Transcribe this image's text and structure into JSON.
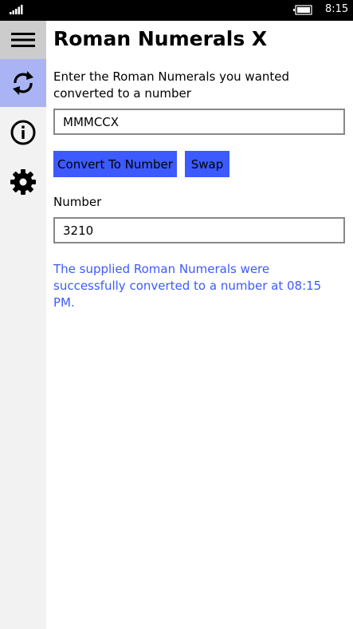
{
  "status_bar": {
    "time": "8:15",
    "icons": [
      "signal-strength-icon",
      "battery-charging-icon"
    ]
  },
  "sidebar": {
    "items": [
      {
        "name": "menu",
        "icon": "hamburger-menu-icon",
        "selected": false
      },
      {
        "name": "convert",
        "icon": "refresh-icon",
        "selected": true
      },
      {
        "name": "about",
        "icon": "info-icon",
        "selected": false
      },
      {
        "name": "settings",
        "icon": "gear-icon",
        "selected": false
      }
    ]
  },
  "main": {
    "title": "Roman Numerals X",
    "prompt": "Enter the Roman Numerals you wanted converted to a number",
    "roman_input_value": "MMMCCX",
    "convert_button_label": "Convert To Number",
    "swap_button_label": "Swap",
    "number_label": "Number",
    "number_output_value": "3210",
    "status_message": "The supplied Roman Numerals were successfully converted to a number at 08:15 PM."
  },
  "colors": {
    "accent": "#3d5afe",
    "sidebar_bg": "#f2f2f2",
    "selected_nav_bg": "#aab4f5",
    "hamburger_bg": "#cccccc",
    "input_border": "#888888"
  }
}
